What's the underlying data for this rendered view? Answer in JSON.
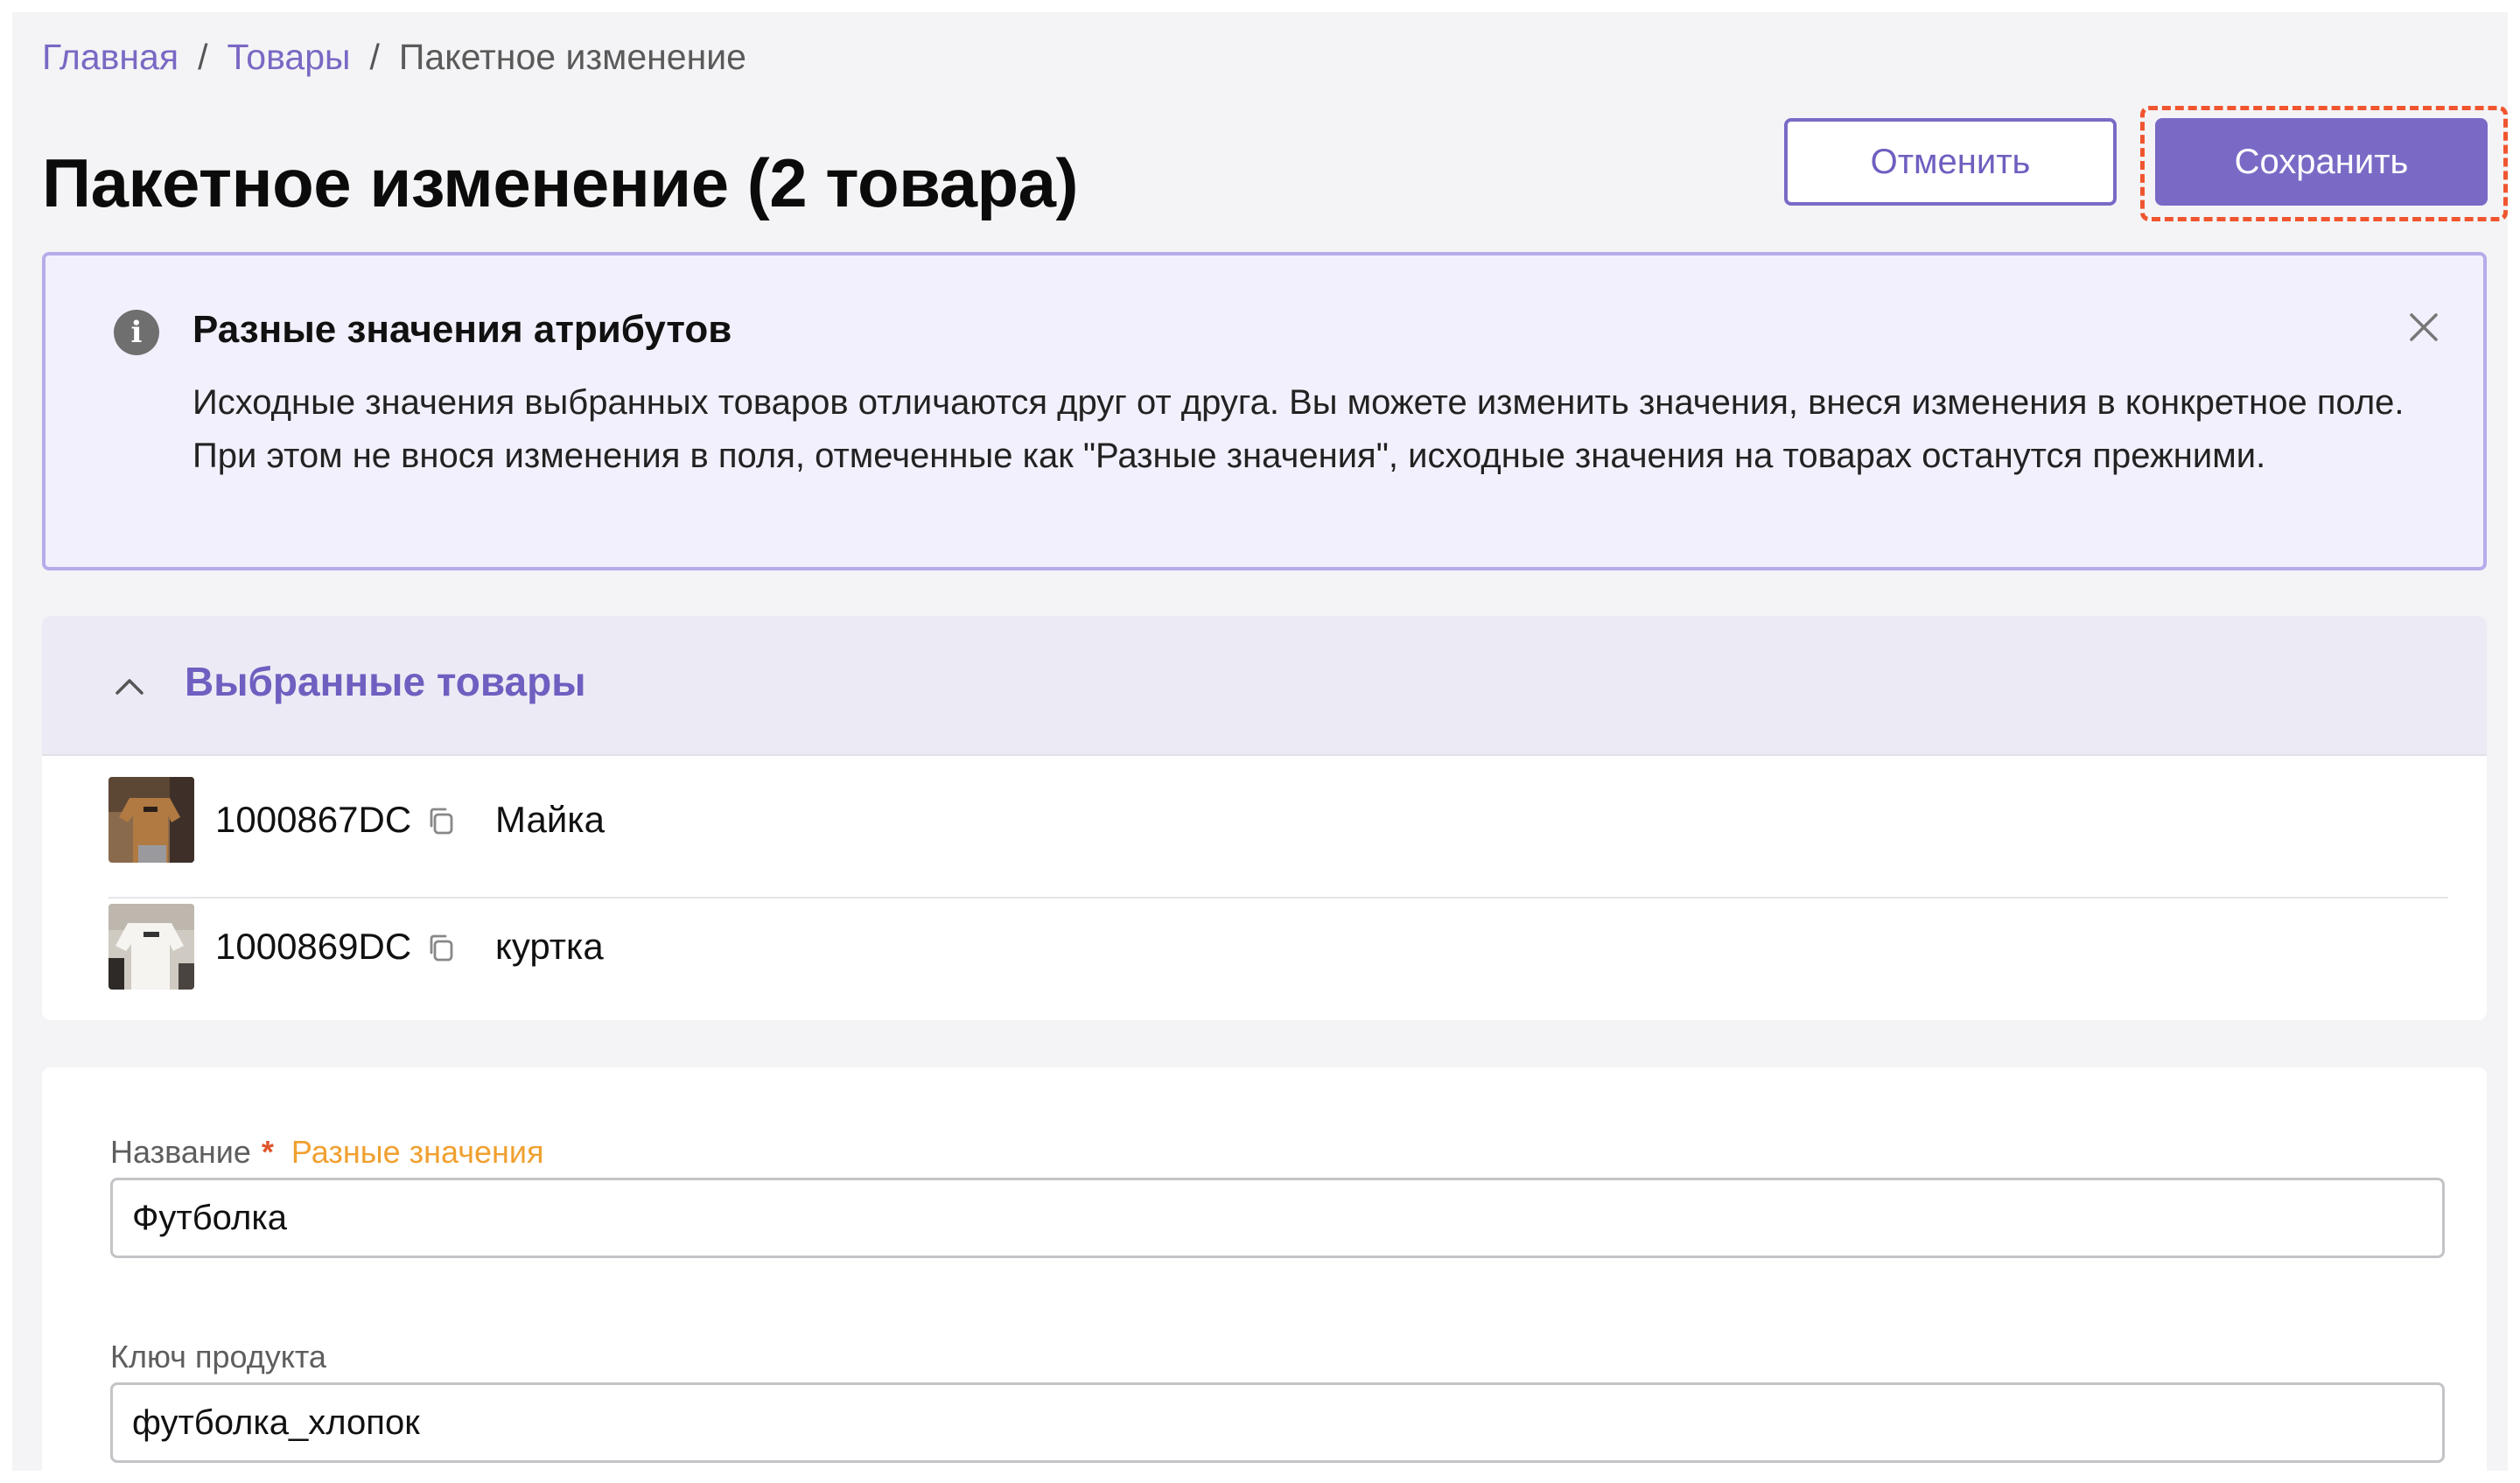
{
  "breadcrumb": {
    "home": "Главная",
    "products": "Товары",
    "current": "Пакетное изменение",
    "separator": "/"
  },
  "page": {
    "title": "Пакетное изменение (2 товара)"
  },
  "actions": {
    "cancel_label": "Отменить",
    "save_label": "Сохранить"
  },
  "alert": {
    "icon": "info-icon",
    "title": "Разные значения атрибутов",
    "text": "Исходные значения выбранных товаров отличаются друг от друга. Вы можете изменить значения, внеся изменения в конкретное поле. При этом не внося изменения в поля, отмеченные как \"Разные значения\", исходные значения на товарах останутся прежними."
  },
  "selected_products": {
    "title": "Выбранные товары",
    "items": [
      {
        "sku": "1000867DC",
        "name": "Майка"
      },
      {
        "sku": "1000869DC",
        "name": "куртка"
      }
    ]
  },
  "form": {
    "name_field": {
      "label": "Название",
      "required_mark": "*",
      "hint": "Разные значения",
      "value": "Футболка"
    },
    "key_field": {
      "label": "Ключ продукта",
      "value": "футболка_хлопок"
    }
  },
  "colors": {
    "accent": "#7a6ac6",
    "highlight": "#f0552f",
    "warning": "#f0a030"
  }
}
